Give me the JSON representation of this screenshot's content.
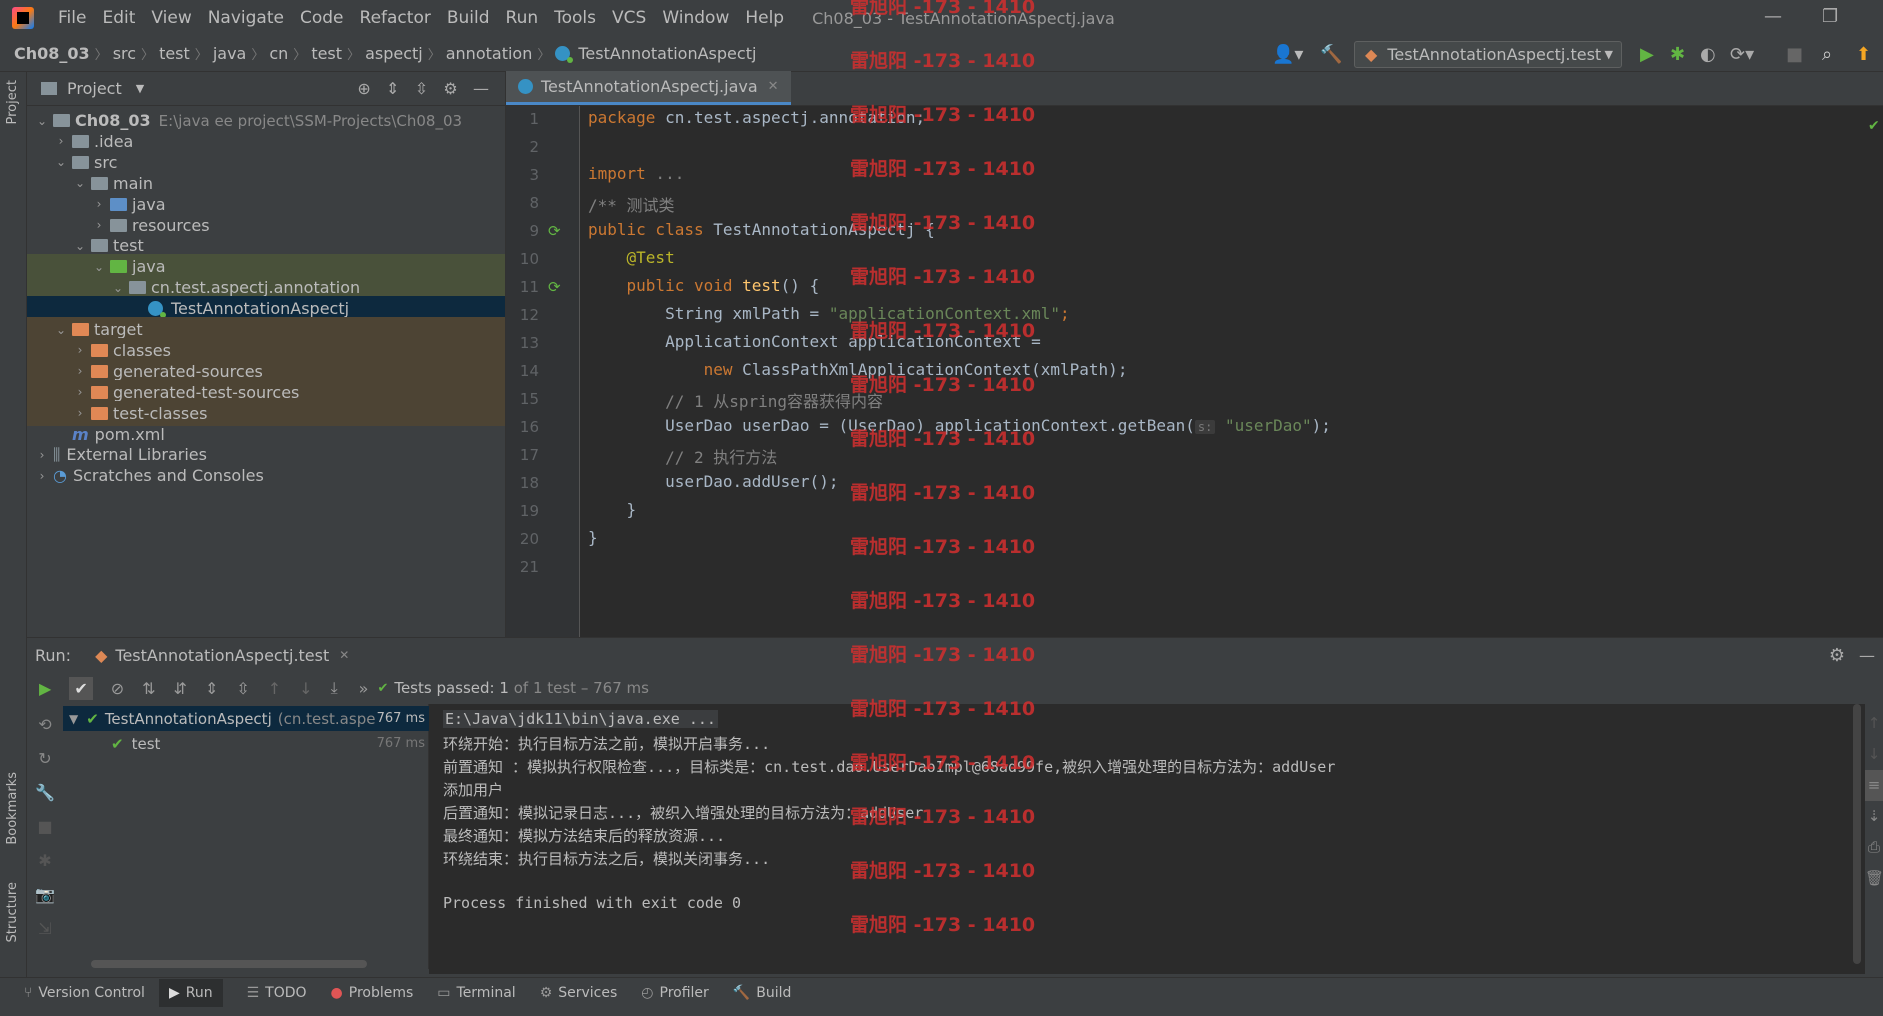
{
  "menu": [
    "File",
    "Edit",
    "View",
    "Navigate",
    "Code",
    "Refactor",
    "Build",
    "Run",
    "Tools",
    "VCS",
    "Window",
    "Help"
  ],
  "window_title": "Ch08_03 - TestAnnotationAspectj.java",
  "breadcrumbs": [
    "Ch08_03",
    "src",
    "test",
    "java",
    "cn",
    "test",
    "aspectj",
    "annotation",
    "TestAnnotationAspectj"
  ],
  "run_config": "TestAnnotationAspectj.test",
  "project_panel": {
    "title": "Project",
    "tree": [
      {
        "label": "Ch08_03",
        "extra": "E:\\java ee project\\SSM-Projects\\Ch08_03",
        "depth": 0,
        "arrow": "open",
        "icon": "folder",
        "bold": true
      },
      {
        "label": ".idea",
        "depth": 1,
        "arrow": "closed",
        "icon": "folder"
      },
      {
        "label": "src",
        "depth": 1,
        "arrow": "open",
        "icon": "folder"
      },
      {
        "label": "main",
        "depth": 2,
        "arrow": "open",
        "icon": "folder"
      },
      {
        "label": "java",
        "depth": 3,
        "arrow": "closed",
        "icon": "folder-blue"
      },
      {
        "label": "resources",
        "depth": 3,
        "arrow": "closed",
        "icon": "folder"
      },
      {
        "label": "test",
        "depth": 2,
        "arrow": "open",
        "icon": "folder"
      },
      {
        "label": "java",
        "depth": 3,
        "arrow": "open",
        "icon": "folder-green"
      },
      {
        "label": "cn.test.aspectj.annotation",
        "depth": 4,
        "arrow": "open",
        "icon": "package"
      },
      {
        "label": "TestAnnotationAspectj",
        "depth": 5,
        "arrow": "none",
        "icon": "class"
      },
      {
        "label": "target",
        "depth": 1,
        "arrow": "open",
        "icon": "folder-orange"
      },
      {
        "label": "classes",
        "depth": 2,
        "arrow": "closed",
        "icon": "folder-orange"
      },
      {
        "label": "generated-sources",
        "depth": 2,
        "arrow": "closed",
        "icon": "folder-orange"
      },
      {
        "label": "generated-test-sources",
        "depth": 2,
        "arrow": "closed",
        "icon": "folder-orange"
      },
      {
        "label": "test-classes",
        "depth": 2,
        "arrow": "closed",
        "icon": "folder-orange"
      },
      {
        "label": "pom.xml",
        "depth": 1,
        "arrow": "none",
        "icon": "maven"
      },
      {
        "label": "External Libraries",
        "depth": 0,
        "arrow": "closed",
        "icon": "lib"
      },
      {
        "label": "Scratches and Consoles",
        "depth": 0,
        "arrow": "closed",
        "icon": "scratch"
      }
    ]
  },
  "editor": {
    "tab": "TestAnnotationAspectj.java",
    "line_numbers": [
      "1",
      "2",
      "3",
      "8",
      "9",
      "10",
      "11",
      "12",
      "13",
      "14",
      "15",
      "16",
      "17",
      "18",
      "19",
      "20",
      "21"
    ],
    "code": {
      "l1_kw": "package",
      "l1_rest": " cn.test.aspectj.annotation;",
      "l3_kw": "import",
      "l3_rest": " ...",
      "l8": "/** 测试类",
      "l9_kw": "public class",
      "l9_rest": " TestAnnotationAspectj {",
      "l10": "    @Test",
      "l11_kw": "    public void",
      "l11_fn": " test",
      "l11_rest": "() {",
      "l12_a": "        String xmlPath = ",
      "l12_str": "\"applicationContext.xml\"",
      "l12_b": ";",
      "l13": "        ApplicationContext applicationContext =",
      "l14_kw": "            new",
      "l14_rest": " ClassPathXmlApplicationContext(xmlPath);",
      "l15": "        // 1 从spring容器获得内容",
      "l16_a": "        UserDao userDao = (UserDao) applicationContext.getBean(",
      "l16_hint": "s:",
      "l16_str": " \"userDao\"",
      "l16_b": ");",
      "l17": "        // 2 执行方法",
      "l18": "        userDao.addUser();",
      "l19": "    }",
      "l20": "}"
    }
  },
  "watermark": "雷旭阳 -173 - 1410",
  "run_panel": {
    "label": "Run:",
    "tab": "TestAnnotationAspectj.test",
    "status_prefix": "Tests passed:",
    "status_count": "1",
    "status_rest": " of 1 test – 767 ms",
    "tests": [
      {
        "name": "TestAnnotationAspectj",
        "extra": "(cn.test.aspe",
        "time": "767 ms"
      },
      {
        "name": "test",
        "extra": "",
        "time": "767 ms"
      }
    ],
    "console": [
      "E:\\Java\\jdk11\\bin\\java.exe ...",
      "环绕开始：执行目标方法之前，模拟开启事务...",
      "前置通知 ：模拟执行权限检查...，目标类是：cn.test.dao.UserDaoImpl@68ad99fe,被织入增强处理的目标方法为：addUser",
      "添加用户",
      "后置通知：模拟记录日志...，被织入增强处理的目标方法为：addUser",
      "最终通知：模拟方法结束后的释放资源...",
      "环绕结束：执行目标方法之后，模拟关闭事务...",
      "",
      "Process finished with exit code 0"
    ]
  },
  "bottom_tabs": [
    "Version Control",
    "Run",
    "TODO",
    "Problems",
    "Terminal",
    "Services",
    "Profiler",
    "Build"
  ],
  "side_labels": {
    "project": "Project",
    "bookmarks": "Bookmarks",
    "structure": "Structure"
  }
}
